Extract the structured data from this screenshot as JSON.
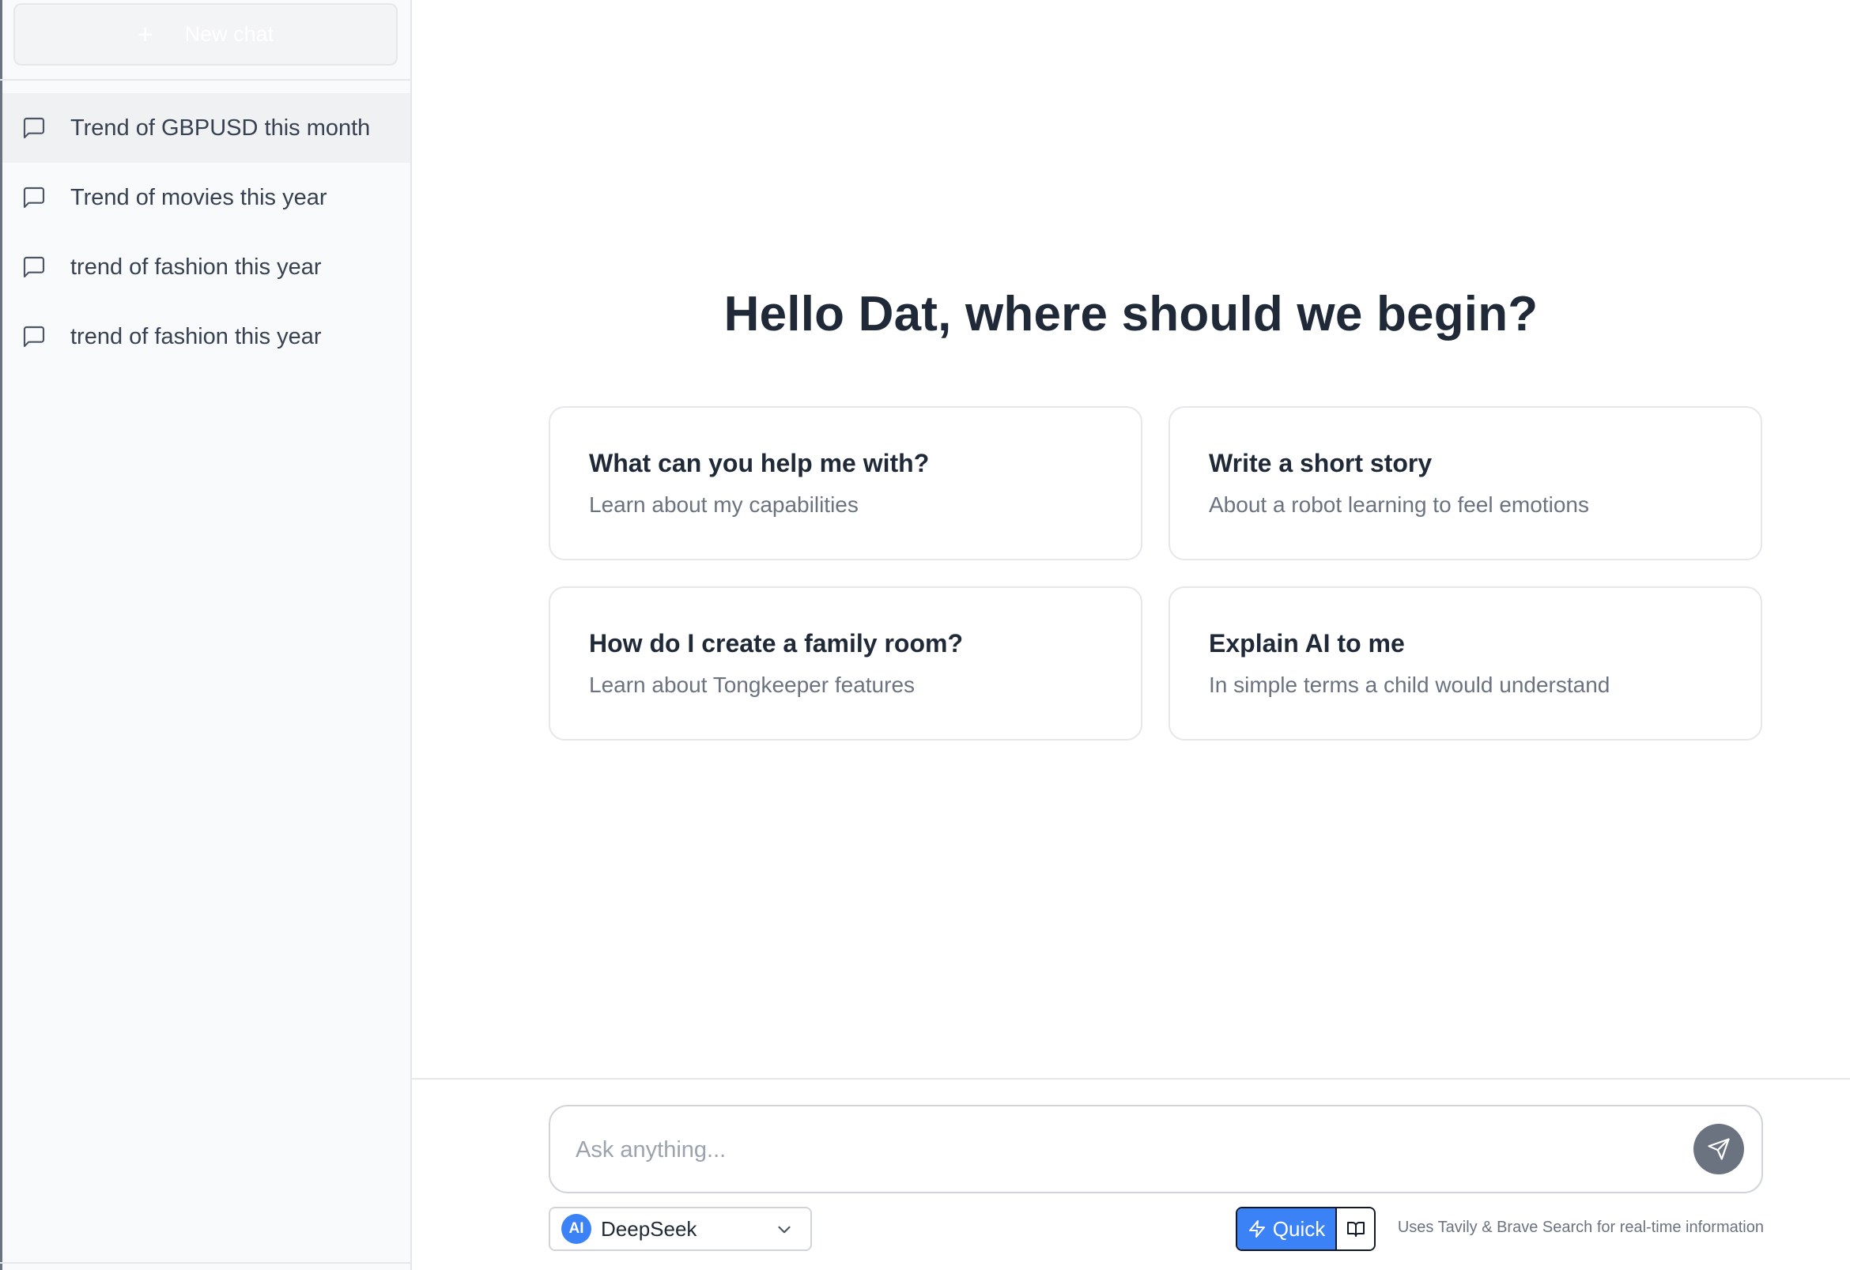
{
  "sidebar": {
    "new_chat_label": "New chat",
    "new_chat_icon": "plus-icon",
    "items": [
      {
        "label": "Trend of GBPUSD this month",
        "icon": "message-square-icon",
        "active": true
      },
      {
        "label": "Trend of movies this year",
        "icon": "message-square-icon",
        "active": false
      },
      {
        "label": "trend of fashion this year",
        "icon": "message-square-icon",
        "active": false
      },
      {
        "label": "trend of fashion this year",
        "icon": "message-square-icon",
        "active": false
      }
    ]
  },
  "main": {
    "greeting": "Hello Dat, where should we begin?",
    "suggestions": [
      {
        "title": "What can you help me with?",
        "subtitle": "Learn about my capabilities"
      },
      {
        "title": "Write a short story",
        "subtitle": "About a robot learning to feel emotions"
      },
      {
        "title": "How do I create a family room?",
        "subtitle": "Learn about Tongkeeper features"
      },
      {
        "title": "Explain AI to me",
        "subtitle": "In simple terms a child would understand"
      }
    ]
  },
  "composer": {
    "placeholder": "Ask anything...",
    "value": "",
    "send_icon": "send-icon"
  },
  "toolbar": {
    "model_badge": "AI",
    "model_name": "DeepSeek",
    "mode_quick_label": "Quick",
    "mode_quick_icon": "lightning-icon",
    "mode_alt_icon": "book-open-icon",
    "footer_note": "Uses Tavily & Brave Search for real-time information"
  },
  "colors": {
    "accent": "#3b82f6",
    "send_button": "#6b7280",
    "sidebar_bg": "#f9fafb",
    "active_item_bg": "#f0f1f3"
  }
}
